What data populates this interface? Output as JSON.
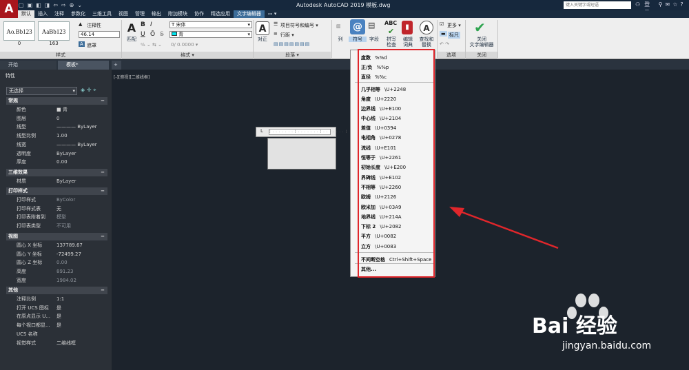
{
  "app": {
    "logo_letter": "A",
    "title": "Autodesk AutoCAD 2019    模板.dwg",
    "search_placeholder": "键入关键字或短语",
    "login_label": "登录",
    "qat": [
      "▢",
      "▣",
      "◧",
      "◨",
      "⇦",
      "⇨",
      "⊕",
      "⌄"
    ],
    "title_icons": [
      "⚲",
      "✉",
      "☆",
      "?",
      "—",
      "☐",
      "✕"
    ]
  },
  "ribbon_tabs": [
    "默认",
    "插入",
    "注释",
    "参数化",
    "三维工具",
    "视图",
    "管理",
    "输出",
    "附加模块",
    "协作",
    "精选应用",
    "文字编辑器",
    "▭ ▾"
  ],
  "ribbon_tabs_active": "默认",
  "ribbon_tabs_context": "文字编辑器",
  "ribbon": {
    "style_swatch_1": "Ao.Bb123",
    "style_swatch_2": "AaBb123",
    "style_swatch_1_num": "0",
    "style_swatch_2_num": "163",
    "annotative_label": "注释性",
    "text_height": "46.14",
    "mask_label": "遮罩",
    "match_label": "匹配",
    "panel_style": "样式",
    "font_name": "宋体",
    "color_name": "青",
    "panel_format": "格式 ▾",
    "justify_label": "对正",
    "bullets_label": "项目符号和编号 ▾",
    "line_spacing_label": "行距 ▾",
    "panel_paragraph": "段落 ▾",
    "column_label": "列",
    "symbol_label": "符号",
    "field_label": "字段",
    "spell_label": "拼写\n检查",
    "dict_label": "编辑\n词典",
    "find_label": "查找和\n替换",
    "more_label": "更多 ▾",
    "ruler_label": "标尺",
    "panel_options": "选项",
    "close_label": "关闭\n文字编辑器",
    "panel_close": "关闭",
    "bold_icon": "B",
    "italic_icon": "I",
    "underline_icon": "U",
    "overline_icon": "Ō",
    "strike_icon": "S"
  },
  "doc_tabs": {
    "start": "开始",
    "drawing": "模板*",
    "add": "+"
  },
  "properties": {
    "title": "特性",
    "selection": "无选择",
    "sections": {
      "general": {
        "title": "常规",
        "rows": [
          {
            "k": "颜色",
            "v": "■ 青"
          },
          {
            "k": "图层",
            "v": "0"
          },
          {
            "k": "线型",
            "v": "———— ByLayer"
          },
          {
            "k": "线型比例",
            "v": "1.00"
          },
          {
            "k": "线宽",
            "v": "———— ByLayer"
          },
          {
            "k": "透明度",
            "v": "ByLayer"
          },
          {
            "k": "厚度",
            "v": "0.00"
          }
        ]
      },
      "3d": {
        "title": "三维效果",
        "rows": [
          {
            "k": "材质",
            "v": "ByLayer"
          }
        ]
      },
      "plot": {
        "title": "打印样式",
        "rows": [
          {
            "k": "打印样式",
            "v": "ByColor",
            "dim": true
          },
          {
            "k": "打印样式表",
            "v": "无"
          },
          {
            "k": "打印表附着到",
            "v": "模型",
            "dim": true
          },
          {
            "k": "打印表类型",
            "v": "不可用",
            "dim": true
          }
        ]
      },
      "view": {
        "title": "视图",
        "rows": [
          {
            "k": "圆心 X 坐标",
            "v": "137789.67"
          },
          {
            "k": "圆心 Y 坐标",
            "v": "-72499.27"
          },
          {
            "k": "圆心 Z 坐标",
            "v": "0.00",
            "dim": true
          },
          {
            "k": "高度",
            "v": "891.23",
            "dim": true
          },
          {
            "k": "宽度",
            "v": "1984.02",
            "dim": true
          }
        ]
      },
      "misc": {
        "title": "其他",
        "rows": [
          {
            "k": "注释比例",
            "v": "1:1"
          },
          {
            "k": "打开 UCS 图标",
            "v": "是"
          },
          {
            "k": "在原点显示 U...",
            "v": "是"
          },
          {
            "k": "每个视口都显...",
            "v": "是"
          },
          {
            "k": "UCS 名称",
            "v": ""
          },
          {
            "k": "视觉样式",
            "v": "二维线框"
          }
        ]
      }
    }
  },
  "viewport_label": "[-][俯视][二维线框]",
  "symbol_menu": [
    {
      "n": "度数",
      "c": "%%d"
    },
    {
      "n": "正/负",
      "c": "%%p"
    },
    {
      "n": "直径",
      "c": "%%c"
    },
    {
      "n": "几乎相等",
      "c": "\\U+2248"
    },
    {
      "n": "角度",
      "c": "\\U+2220"
    },
    {
      "n": "边界线",
      "c": "\\U+E100"
    },
    {
      "n": "中心线",
      "c": "\\U+2104"
    },
    {
      "n": "差值",
      "c": "\\U+0394"
    },
    {
      "n": "电相角",
      "c": "\\U+0278"
    },
    {
      "n": "流线",
      "c": "\\U+E101"
    },
    {
      "n": "恒等于",
      "c": "\\U+2261"
    },
    {
      "n": "初始长度",
      "c": "\\U+E200"
    },
    {
      "n": "界碑线",
      "c": "\\U+E102"
    },
    {
      "n": "不相等",
      "c": "\\U+2260"
    },
    {
      "n": "欧姆",
      "c": "\\U+2126"
    },
    {
      "n": "欧米加",
      "c": "\\U+03A9"
    },
    {
      "n": "地界线",
      "c": "\\U+214A"
    },
    {
      "n": "下标 2",
      "c": "\\U+2082"
    },
    {
      "n": "平方",
      "c": "\\U+0082"
    },
    {
      "n": "立方",
      "c": "\\U+0083"
    },
    {
      "n": "不间断空格",
      "c": "Ctrl+Shift+Space"
    },
    {
      "n": "其他...",
      "c": ""
    }
  ],
  "watermark": {
    "brand": "Bai 经验",
    "url": "jingyan.baidu.com"
  },
  "colors": {
    "accent": "#3d6d99",
    "highlight": "#e0262b",
    "title_bar": "#16283d",
    "canvas": "#1c232c",
    "cyan": "#00e5ee"
  }
}
